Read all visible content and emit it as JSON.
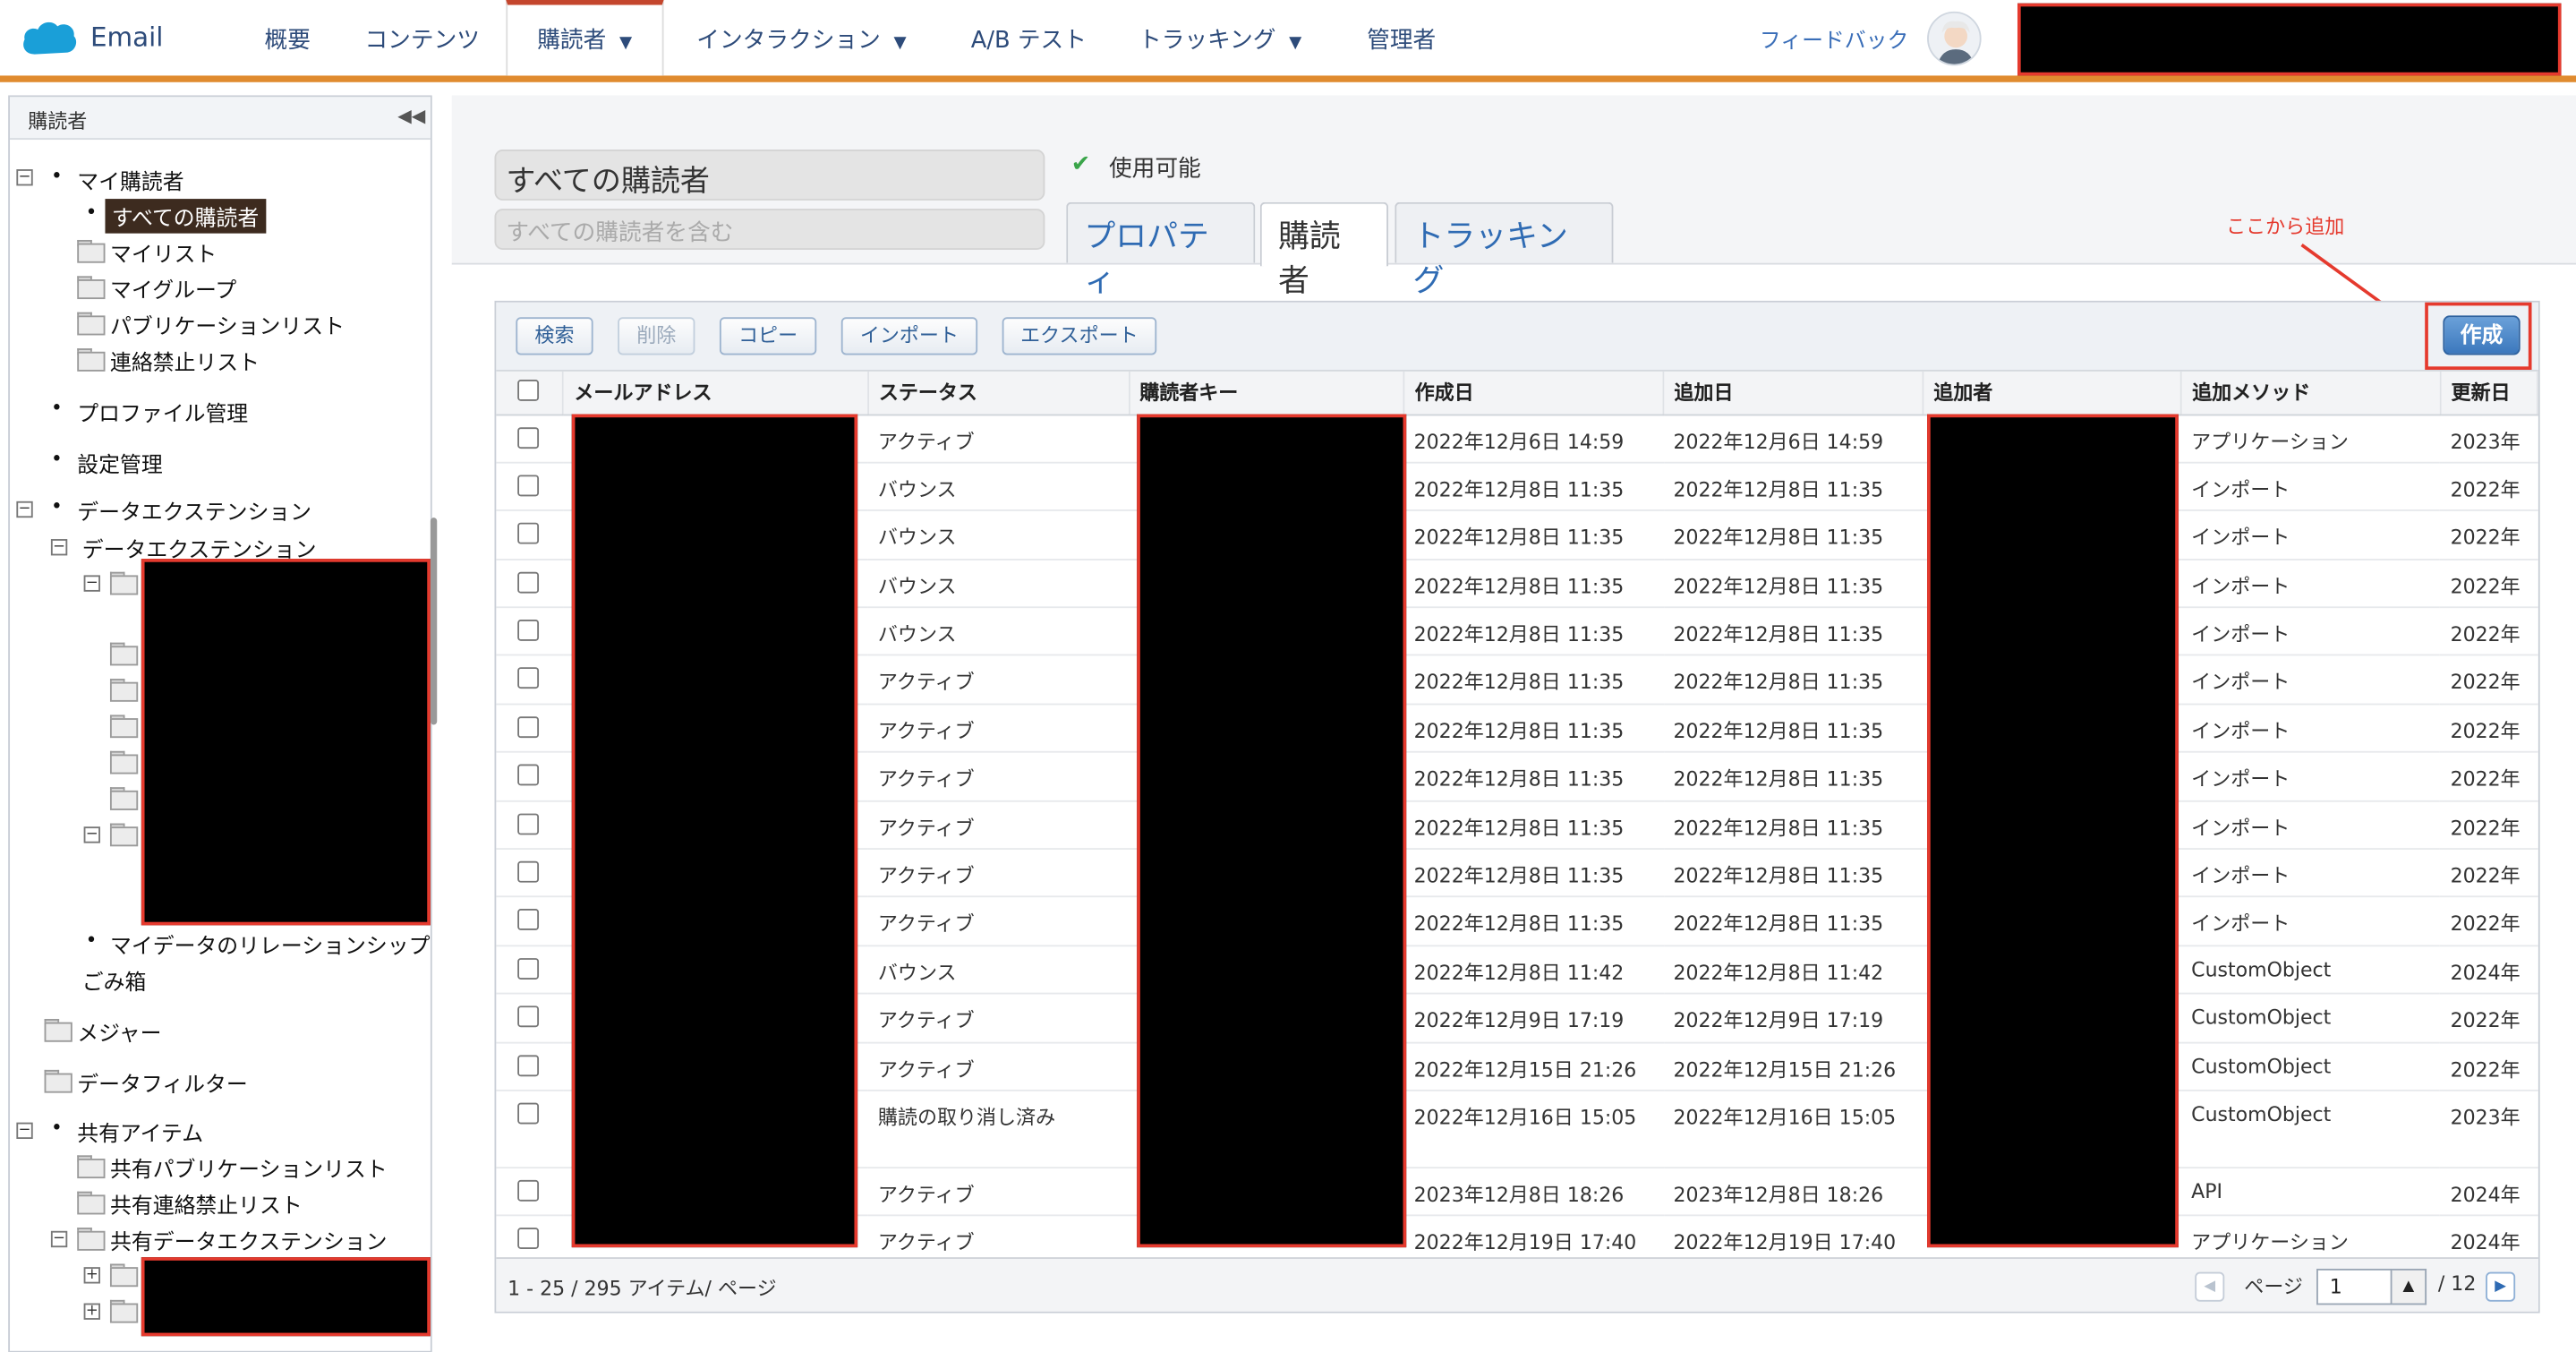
{
  "app": {
    "name": "Email"
  },
  "nav": {
    "items": [
      {
        "label": "概要",
        "caret": false
      },
      {
        "label": "コンテンツ",
        "caret": false
      },
      {
        "label": "購読者",
        "caret": true
      },
      {
        "label": "インタラクション",
        "caret": true
      },
      {
        "label": "A/B テスト",
        "caret": false
      },
      {
        "label": "トラッキング",
        "caret": true
      },
      {
        "label": "管理者",
        "caret": false
      }
    ],
    "caret_glyph": "▼",
    "feedback": "フィードバック",
    "active": "購読者"
  },
  "sidebar": {
    "title": "購読者",
    "collapse_glyph": "◀◀",
    "items": [
      "マイ購読者",
      "すべての購読者",
      "マイリスト",
      "マイグループ",
      "パブリケーションリスト",
      "連絡禁止リスト",
      "プロファイル管理",
      "設定管理",
      "データエクステンション",
      "データエクステンション",
      "マイデータのリレーションシップ",
      "ごみ箱",
      "メジャー",
      "データフィルター",
      "共有アイテム",
      "共有パブリケーションリスト",
      "共有連絡禁止リスト",
      "共有データエクステンション"
    ],
    "selected": "すべての購読者"
  },
  "header": {
    "name_value": "すべての購読者",
    "desc_placeholder": "すべての購読者を含む",
    "status_icon": "✔",
    "status": "使用可能",
    "tabs": [
      "プロパティ",
      "購読者",
      "トラッキング"
    ],
    "active_tab": "購読者",
    "annotation": "ここから追加"
  },
  "toolbar": {
    "buttons": [
      "検索",
      "削除",
      "コピー",
      "インポート",
      "エクスポート"
    ],
    "create": "作成"
  },
  "table": {
    "columns": [
      "メールアドレス",
      "ステータス",
      "購読者キー",
      "作成日",
      "追加日",
      "追加者",
      "追加メソッド",
      "更新日"
    ],
    "rows": [
      {
        "status": "アクティブ",
        "created": "2022年12月6日 14:59",
        "added": "2022年12月6日 14:59",
        "method": "アプリケーション",
        "updated": "2023年"
      },
      {
        "status": "バウンス",
        "created": "2022年12月8日 11:35",
        "added": "2022年12月8日 11:35",
        "method": "インポート",
        "updated": "2022年"
      },
      {
        "status": "バウンス",
        "created": "2022年12月8日 11:35",
        "added": "2022年12月8日 11:35",
        "method": "インポート",
        "updated": "2022年"
      },
      {
        "status": "バウンス",
        "created": "2022年12月8日 11:35",
        "added": "2022年12月8日 11:35",
        "method": "インポート",
        "updated": "2022年"
      },
      {
        "status": "バウンス",
        "created": "2022年12月8日 11:35",
        "added": "2022年12月8日 11:35",
        "method": "インポート",
        "updated": "2022年"
      },
      {
        "status": "アクティブ",
        "created": "2022年12月8日 11:35",
        "added": "2022年12月8日 11:35",
        "method": "インポート",
        "updated": "2022年"
      },
      {
        "status": "アクティブ",
        "created": "2022年12月8日 11:35",
        "added": "2022年12月8日 11:35",
        "method": "インポート",
        "updated": "2022年"
      },
      {
        "status": "アクティブ",
        "created": "2022年12月8日 11:35",
        "added": "2022年12月8日 11:35",
        "method": "インポート",
        "updated": "2022年"
      },
      {
        "status": "アクティブ",
        "created": "2022年12月8日 11:35",
        "added": "2022年12月8日 11:35",
        "method": "インポート",
        "updated": "2022年"
      },
      {
        "status": "アクティブ",
        "created": "2022年12月8日 11:35",
        "added": "2022年12月8日 11:35",
        "method": "インポート",
        "updated": "2022年"
      },
      {
        "status": "アクティブ",
        "created": "2022年12月8日 11:35",
        "added": "2022年12月8日 11:35",
        "method": "インポート",
        "updated": "2022年"
      },
      {
        "status": "バウンス",
        "created": "2022年12月8日 11:42",
        "added": "2022年12月8日 11:42",
        "method": "CustomObject",
        "updated": "2024年"
      },
      {
        "status": "アクティブ",
        "created": "2022年12月9日 17:19",
        "added": "2022年12月9日 17:19",
        "method": "CustomObject",
        "updated": "2022年"
      },
      {
        "status": "アクティブ",
        "created": "2022年12月15日 21:26",
        "added": "2022年12月15日 21:26",
        "method": "CustomObject",
        "updated": "2022年"
      },
      {
        "status": "購読の取り消し済み",
        "created": "2022年12月16日 15:05",
        "added": "2022年12月16日 15:05",
        "method": "CustomObject",
        "updated": "2023年"
      },
      {
        "status": "アクティブ",
        "created": "2023年12月8日 18:26",
        "added": "2023年12月8日 18:26",
        "method": "API",
        "updated": "2024年"
      },
      {
        "status": "アクティブ",
        "created": "2022年12月19日 17:40",
        "added": "2022年12月19日 17:40",
        "method": "アプリケーション",
        "updated": "2024年"
      }
    ]
  },
  "pager": {
    "summary": "1 - 25 / 295 アイテム/ ページ",
    "label": "ページ",
    "value": "1",
    "total": "/ 12",
    "prev_glyph": "◀",
    "next_glyph": "▶",
    "spin_glyph": "▲"
  }
}
